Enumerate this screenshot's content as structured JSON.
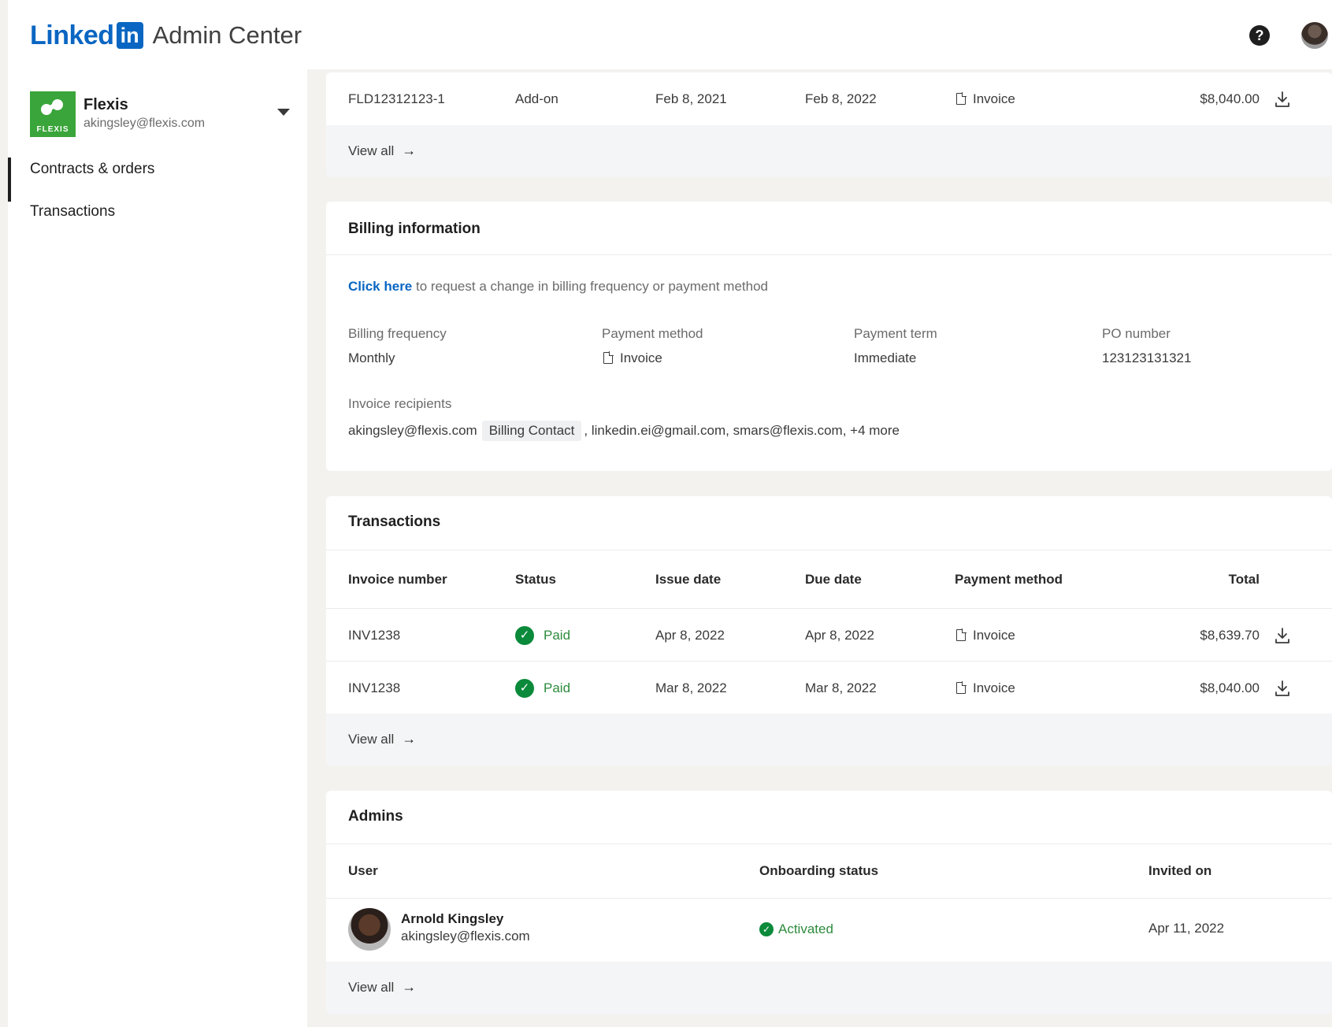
{
  "header": {
    "brand_linked": "Linked",
    "brand_in": "in",
    "brand_title": "Admin Center",
    "help_icon": "question-circle-icon",
    "avatar_icon": "user-avatar"
  },
  "sidebar": {
    "org": {
      "logo_text": "FLEXIS",
      "name": "Flexis",
      "email": "akingsley@flexis.com"
    },
    "items": [
      {
        "label": "Contracts & orders",
        "active": true
      },
      {
        "label": "Transactions",
        "active": false
      }
    ]
  },
  "contracts": {
    "row": {
      "id": "FLD12312123-1",
      "type": "Add-on",
      "start": "Feb 8, 2021",
      "end": "Feb 8, 2022",
      "method": "Invoice",
      "total": "$8,040.00"
    },
    "view_all": "View all",
    "arrow": "→"
  },
  "billing": {
    "title": "Billing information",
    "request_link": "Click here",
    "request_text": " to request a change in billing frequency or payment method",
    "fields": [
      {
        "label": "Billing frequency",
        "value": "Monthly"
      },
      {
        "label": "Payment method",
        "value": "Invoice"
      },
      {
        "label": "Payment term",
        "value": "Immediate"
      },
      {
        "label": "PO number",
        "value": "123123131321"
      }
    ],
    "recipients_label": "Invoice recipients",
    "recipient_primary": "akingsley@flexis.com",
    "recipient_chip": "Billing Contact",
    "recipient_rest": ", linkedin.ei@gmail.com, smars@flexis.com, +4 more"
  },
  "transactions": {
    "title": "Transactions",
    "columns": [
      "Invoice number",
      "Status",
      "Issue date",
      "Due date",
      "Payment method",
      "Total"
    ],
    "rows": [
      {
        "invoice": "INV1238",
        "status": "Paid",
        "issue": "Apr 8, 2022",
        "due": "Apr 8, 2022",
        "method": "Invoice",
        "total": "$8,639.70"
      },
      {
        "invoice": "INV1238",
        "status": "Paid",
        "issue": "Mar 8, 2022",
        "due": "Mar 8, 2022",
        "method": "Invoice",
        "total": "$8,040.00"
      }
    ],
    "view_all": "View all",
    "arrow": "→"
  },
  "admins": {
    "title": "Admins",
    "columns": [
      "User",
      "Onboarding status",
      "Invited on"
    ],
    "rows": [
      {
        "name": "Arnold Kingsley",
        "email": "akingsley@flexis.com",
        "status": "Activated",
        "invited": "Apr 11, 2022"
      }
    ],
    "view_all": "View all",
    "arrow": "→"
  },
  "colors": {
    "brand": "#0a66c2",
    "success": "#0a8a3a",
    "org_green": "#3aa53a",
    "page_bg": "#f3f2ef"
  }
}
